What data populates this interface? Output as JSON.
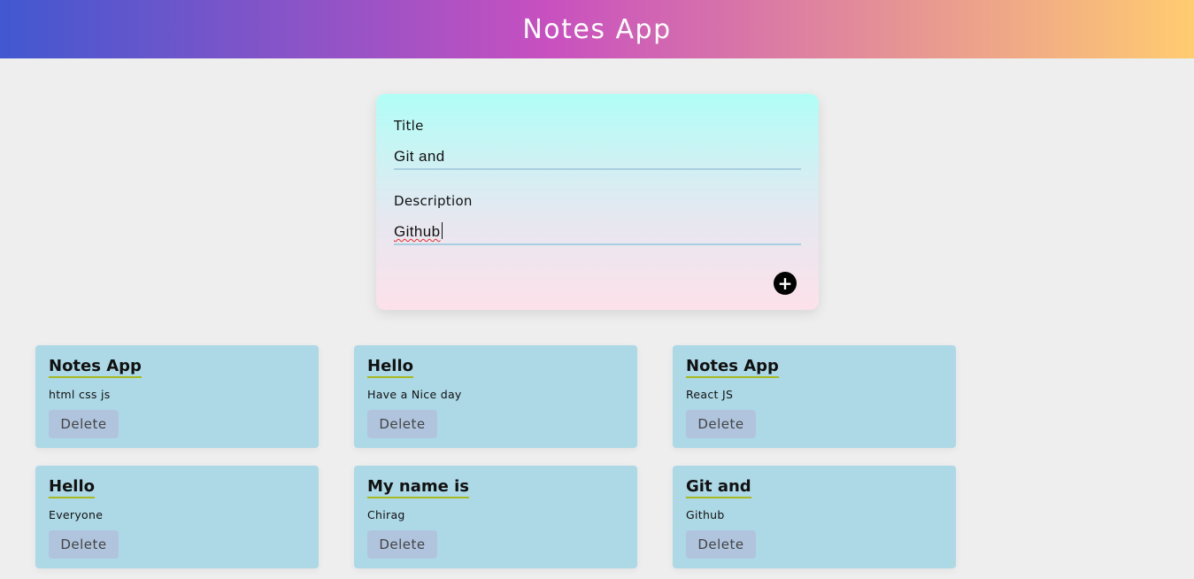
{
  "header": {
    "title": "Notes App"
  },
  "form": {
    "title_label": "Title",
    "title_value": "Git and",
    "description_label": "Description",
    "description_value": "Github",
    "add_icon": "plus-circle-icon",
    "add_glyph": "+"
  },
  "notes": [
    {
      "title": "Notes App",
      "description": "html css js",
      "delete_label": "Delete"
    },
    {
      "title": "Hello",
      "description": "Have a Nice day",
      "delete_label": "Delete"
    },
    {
      "title": "Notes App",
      "description": "React JS",
      "delete_label": "Delete"
    },
    {
      "title": "Hello",
      "description": "Everyone",
      "delete_label": "Delete"
    },
    {
      "title": "My name is",
      "description": "Chirag",
      "delete_label": "Delete"
    },
    {
      "title": "Git and",
      "description": "Github",
      "delete_label": "Delete"
    }
  ],
  "colors": {
    "background": "#eeeeee",
    "note_card": "#add8e6",
    "delete_button": "#b0c4de",
    "title_underline": "#a8b820"
  }
}
